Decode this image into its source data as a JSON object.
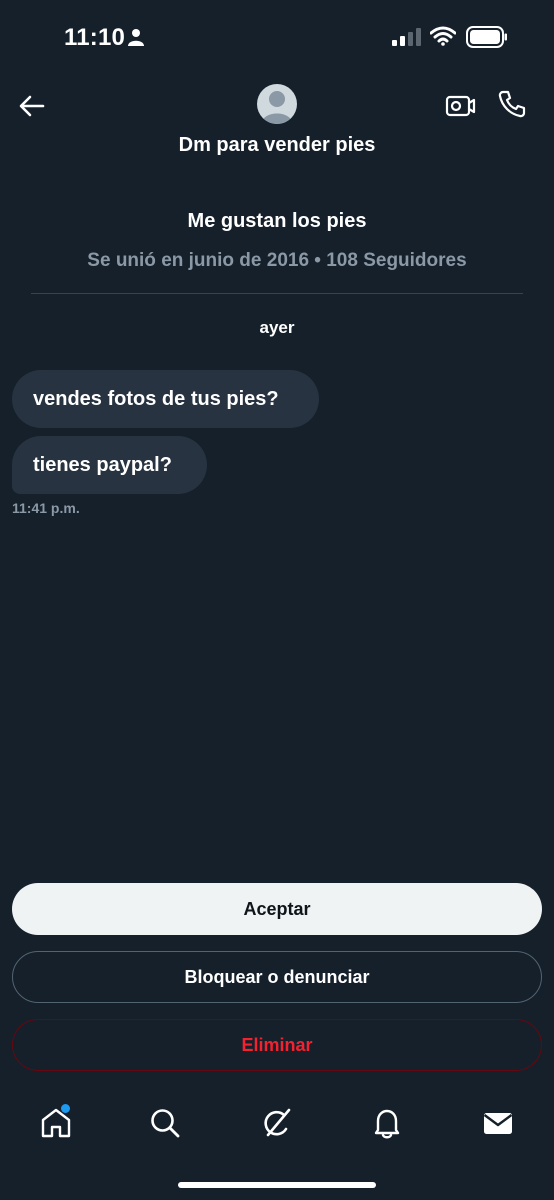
{
  "status_bar": {
    "time": "11:10"
  },
  "header": {
    "name": "Dm para vender pies"
  },
  "profile": {
    "bio": "Me gustan los pies",
    "meta": "Se unió en junio de 2016 • 108 Seguidores"
  },
  "conversation": {
    "day_label": "ayer",
    "messages": [
      {
        "text": "vendes fotos de tus pies?"
      },
      {
        "text": "tienes paypal?"
      }
    ],
    "last_time": "11:41 p.m."
  },
  "actions": {
    "accept": "Aceptar",
    "block_report": "Bloquear o denunciar",
    "delete": "Eliminar"
  },
  "nav": {
    "items": [
      "home-icon",
      "search-icon",
      "grok-icon",
      "notifications-icon",
      "messages-icon"
    ],
    "home_has_badge": true
  },
  "colors": {
    "background": "#15202b",
    "bubble": "#273340",
    "muted_text": "#8b98a5",
    "accent": "#1d9bf0",
    "danger": "#f4212e"
  }
}
